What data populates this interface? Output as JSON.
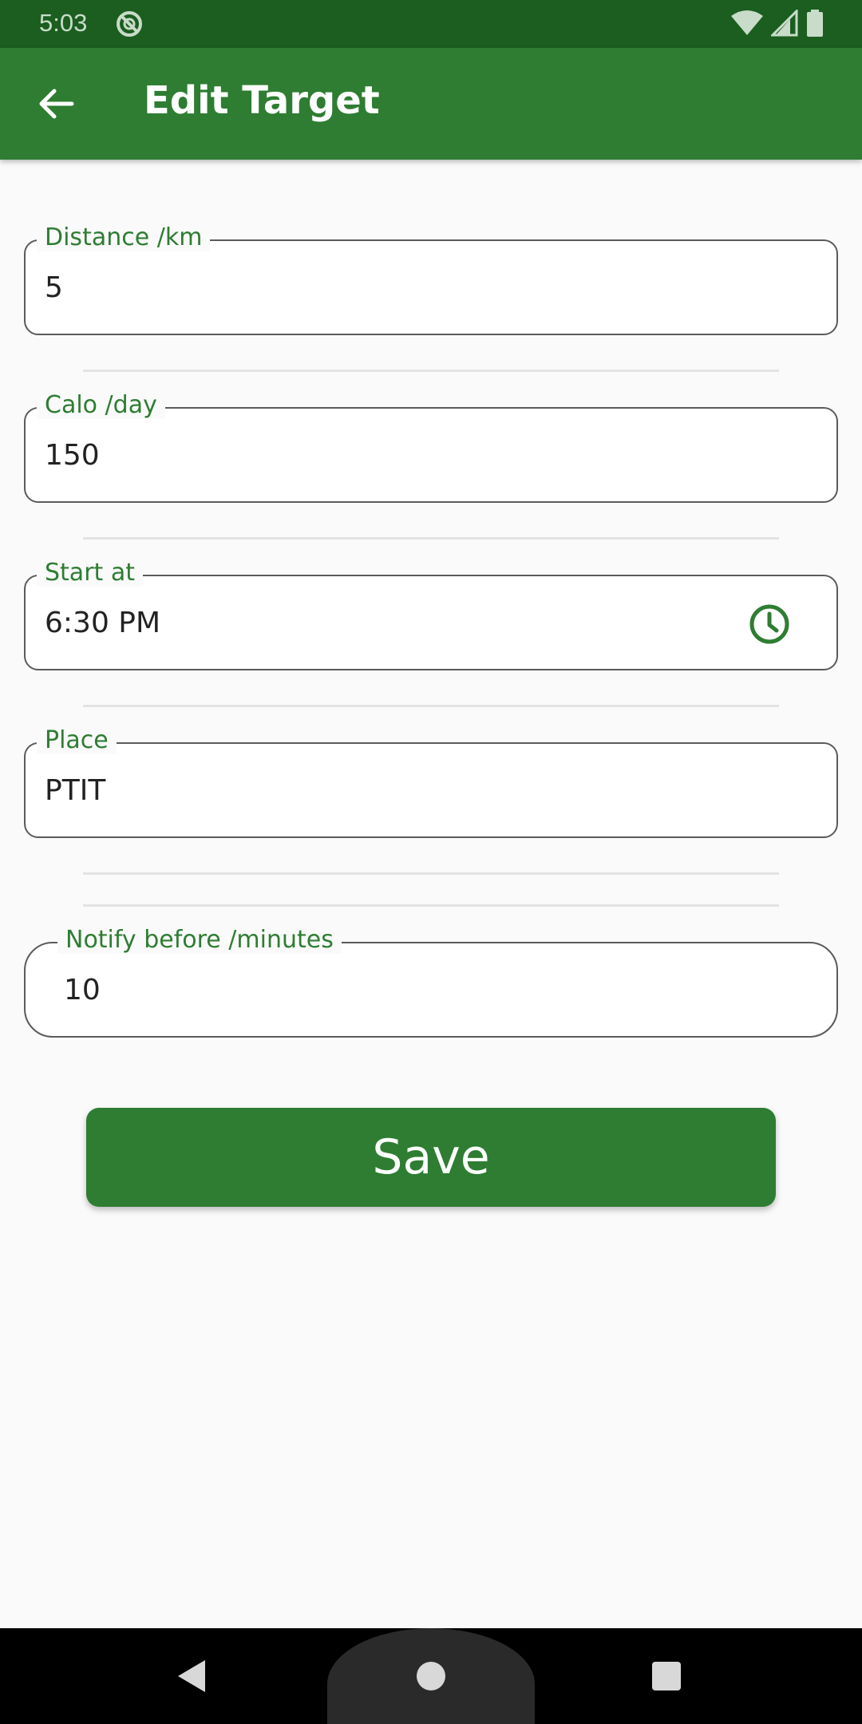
{
  "status_bar": {
    "time": "5:03",
    "icons": [
      "dnd-icon",
      "wifi-icon",
      "signal-icon",
      "battery-icon"
    ]
  },
  "app_bar": {
    "title": "Edit Target",
    "back_icon": "arrow-back-icon",
    "background_color": "#2e7d32"
  },
  "form": {
    "distance": {
      "label": "Distance /km",
      "value": "5"
    },
    "calo": {
      "label": "Calo /day",
      "value": "150"
    },
    "start_at": {
      "label": "Start at",
      "value": "6:30 PM",
      "icon": "clock-icon"
    },
    "place": {
      "label": "Place",
      "value": "PTIT"
    },
    "notify": {
      "label": "Notify before /minutes",
      "value": "10"
    }
  },
  "save_button": {
    "label": "Save"
  },
  "colors": {
    "accent": "#2e7d32",
    "status_bar": "#1b5e20",
    "label": "#2e7d32"
  },
  "nav_bar": {
    "icons": [
      "nav-back-icon",
      "nav-home-icon",
      "nav-recents-icon"
    ]
  }
}
